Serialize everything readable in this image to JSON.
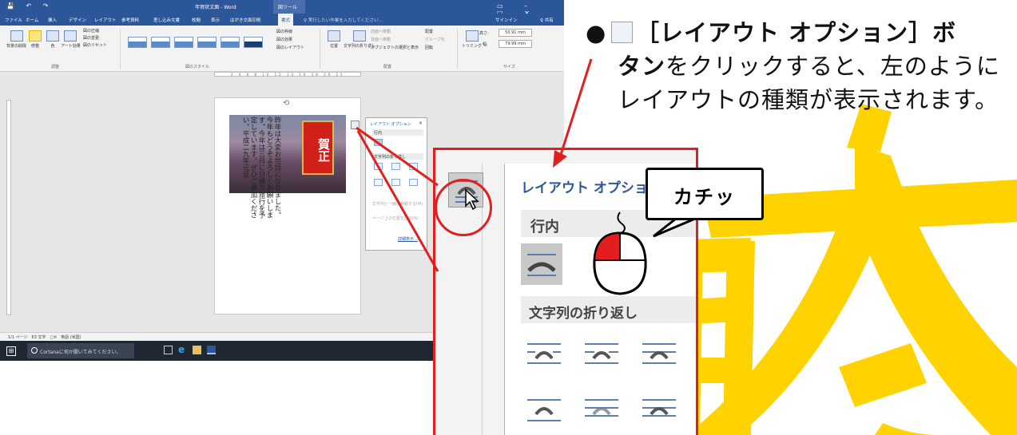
{
  "word": {
    "title": "年賀状文面 - Word",
    "context_tab": "図ツール",
    "tabs": [
      "ファイル",
      "ホーム",
      "挿入",
      "デザイン",
      "レイアウト",
      "参考資料",
      "差し込み文書",
      "校閲",
      "表示",
      "はがき文面印刷",
      "書式"
    ],
    "active_tab": "書式",
    "tell_me": "♀ 実行したい作業を入力してください...",
    "signin": "サインイン",
    "share": "♀ 共有",
    "ribbon": {
      "remove_bg": "背景の削除",
      "corrections": "修整",
      "color": "色",
      "art_effects": "アート効果",
      "compress": "図の圧縮",
      "change_pic": "図の変更",
      "reset_pic": "図のリセット",
      "group_adjust": "調整",
      "group_styles": "図のスタイル",
      "border": "図の枠線",
      "effects": "図の効果",
      "layout": "図のレイアウト",
      "position": "位置",
      "wrap": "文字列の折り返し",
      "bring_fwd": "前面へ移動",
      "send_back": "背面へ移動",
      "selection_pane": "オブジェクトの選択と表示",
      "align": "配置",
      "group": "グループ化",
      "rotate": "回転",
      "group_arrange": "配置",
      "crop": "トリミング",
      "height": "50.91 mm",
      "width": "79.99 mm",
      "height_label": "高さ:",
      "width_label": "幅:",
      "group_size": "サイズ"
    },
    "ruler_ticks": "2 4 6 8 10 12 14 16 18 20 22",
    "doc_vertical_text": "昨年は大変お世話になりました。今年もどうぞよろしくお願いします。今年は三月に日帰り旅行を予定しています。ぜひご参加ください。平成二九年元旦",
    "card_text": "賀正",
    "mini_panel": {
      "title": "レイアウト オプション",
      "close": "×",
      "inline": "行内",
      "wrap": "文字列の折り返し",
      "opt1": "文字列と一緒に移動する(M)",
      "opt2": "ページ上の位置を固定(N)",
      "details": "詳細表示..."
    },
    "status": "1/1 ページ　63 文字　□ߚ　英語 (米国)",
    "taskbar": {
      "cortana": "Cortanaに何か聞いてみてください。"
    }
  },
  "annotation": {
    "bullet": "●",
    "line1_bold": "［レイアウト オプション］ボ",
    "line2_bold": "タン",
    "line2_rest": "をクリックすると、左のように",
    "line3": "レイアウトの種類が表示されます。"
  },
  "zoom": {
    "title": "レイアウト オプション",
    "section_inline": "行内",
    "section_wrap": "文字列の折り返し"
  },
  "bubble": "カチッ",
  "colors": {
    "word_blue": "#2b579a",
    "annotation_red": "#e02020",
    "watermark_yellow": "#ffd200"
  }
}
